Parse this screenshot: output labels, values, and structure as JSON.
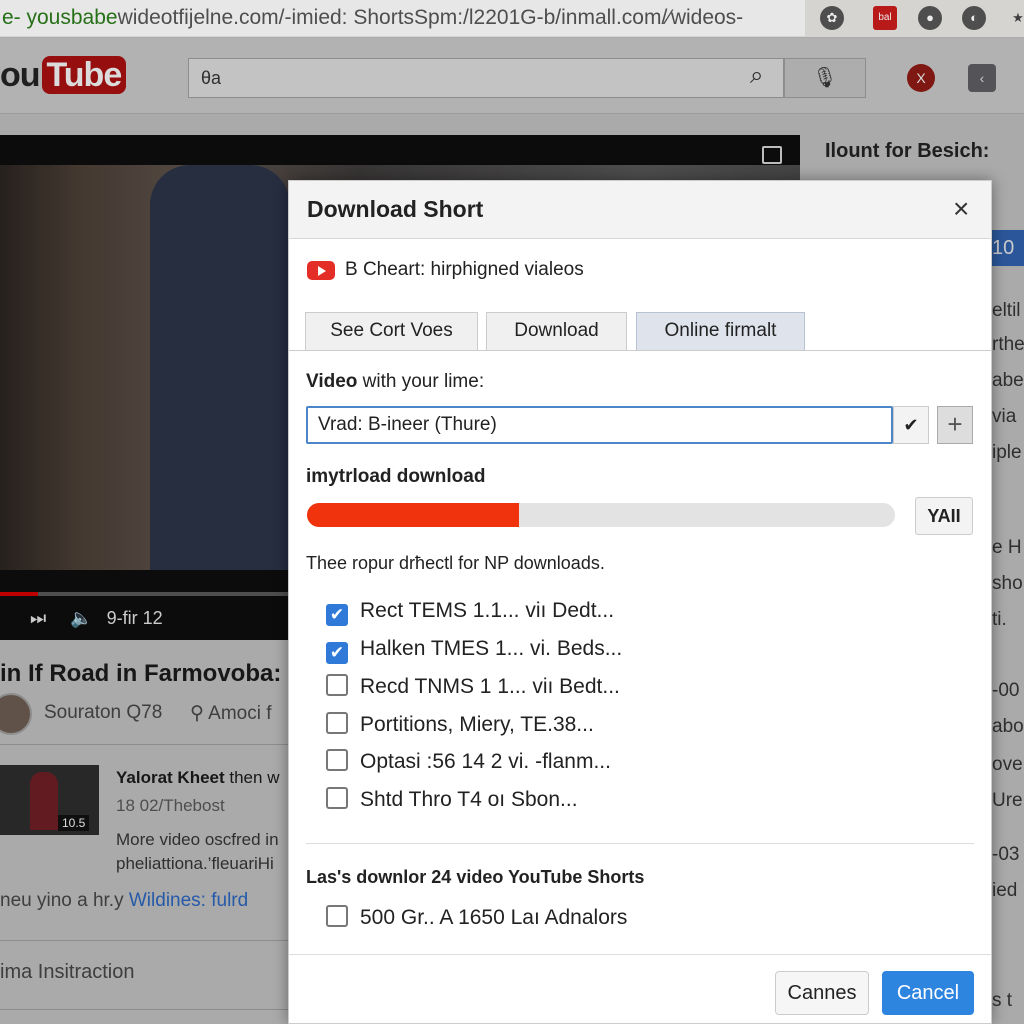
{
  "browser": {
    "url_prefix": "e- yousbabe",
    "url_rest": "wideotfijelne.com/-imied: ShortsSpm:/l2201G-b/inmall.com/∕wideos-",
    "ext_label": "bal"
  },
  "youtube": {
    "logo_left": "ou",
    "logo_box": "Tube",
    "search_value": "θa",
    "avatar_letter": "X"
  },
  "player": {
    "time": "9-fir 12"
  },
  "video": {
    "title": "in If Road in Farmovoba: f",
    "channel": "Souraton Q78",
    "meta": "Amoci f"
  },
  "related": {
    "duration": "10.5",
    "title_bold": "Yalorat Kheet",
    "title_rest": " then w",
    "meta": "18 02/Thebost",
    "desc1": "More video oscfred in",
    "desc2": "pheliattiona.’fleuariHi",
    "more_text": "neu  yino a hr.y ",
    "more_link": "Wildines: fulrd",
    "section": "ima Insitraction"
  },
  "sidebar": {
    "title": "Ilount for Besich:",
    "badge": "10",
    "lines": [
      "eltil",
      "rthe",
      "abe",
      "via",
      "iple",
      "e H",
      "sho",
      "ti.",
      "-00",
      "abo",
      "ove",
      "Ure..",
      "-03",
      "ied",
      "s t"
    ]
  },
  "dialog": {
    "title": "Download Short",
    "close": "×",
    "video_name": "B Cheart: hirphigned vialeos",
    "tabs": [
      {
        "label": "See Cort Voes"
      },
      {
        "label": "Download"
      },
      {
        "label": "Online firmalt",
        "active": true
      }
    ],
    "label_bold": "Video",
    "label_rest": " with your lime:",
    "field_value": "Vrad: B-ineer (Thure)",
    "check": "✔",
    "plus": "+",
    "progress_label": "imytrload download",
    "progress_percent": 36,
    "progress_button": "YAII",
    "hint": "Thee ropur drħectl for NP downloads.",
    "options": [
      {
        "label": "Rect TEMS 1.1... viı  Dedt...",
        "checked": true
      },
      {
        "label": "Halken TMES 1... vi.  Beds...",
        "checked": true
      },
      {
        "label": "Recd TNMS 1 1... viı  Bedt...",
        "checked": false
      },
      {
        "label": "Portitions, Miery, TE.38...",
        "checked": false
      },
      {
        "label": "Optasi :56 14 2 vi.  -flanm...",
        "checked": false
      },
      {
        "label": "Shtd Thro T4 oı  Sbon...",
        "checked": false
      }
    ],
    "last_label": "Las's downlor 24 video YouTube Shorts",
    "last_option": {
      "label": "500 Gr.. A 1650 Laı  Adnalors",
      "checked": false
    },
    "btn_secondary": "Cannes",
    "btn_primary": "Cancel"
  },
  "colors": {
    "accent": "#2e85e0",
    "progress": "#f0330c",
    "youtube_red": "#e52d27"
  }
}
